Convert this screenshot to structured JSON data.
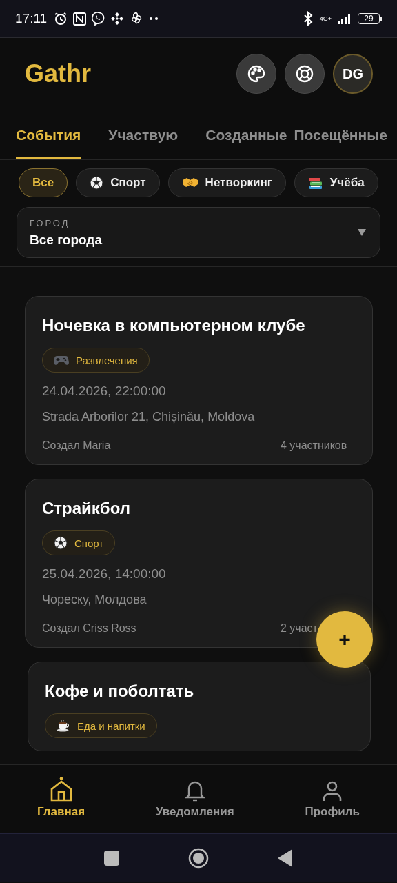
{
  "status_bar": {
    "time": "17:11",
    "network": "4G+",
    "battery": "29"
  },
  "header": {
    "title": "Gathr",
    "avatar": "DG"
  },
  "tabs": [
    {
      "label": "События",
      "selected": true
    },
    {
      "label": "Участвую",
      "selected": false
    },
    {
      "label": "Созданные",
      "selected": false
    },
    {
      "label": "Посещённые",
      "selected": false
    }
  ],
  "chips": [
    {
      "label": "Все",
      "kind": "all",
      "selected": true
    },
    {
      "label": "Спорт",
      "kind": "sport",
      "selected": false
    },
    {
      "label": "Нетворкинг",
      "kind": "networking",
      "selected": false
    },
    {
      "label": "Учёба",
      "kind": "study",
      "selected": false
    }
  ],
  "city_filter": {
    "label": "ГОРОД",
    "value": "Все города"
  },
  "events": [
    {
      "title": "Ночевка в компьютерном клубе",
      "tag": "Развлечения",
      "kind": "entertainment",
      "date": "24.04.2026, 22:00:00",
      "address": "Strada Arborilor 21, Chișinău, Moldova",
      "author": "Создал Maria",
      "participants": "4 участников"
    },
    {
      "title": "Страйкбол",
      "tag": "Спорт",
      "kind": "sport",
      "date": "25.04.2026, 14:00:00",
      "address": "Чореску, Молдова",
      "author": "Создал Criss Ross",
      "participants": "2 участ"
    },
    {
      "title": "Кофе и поболтать",
      "tag": "Еда и напитки",
      "kind": "food"
    }
  ],
  "fab": {
    "label": "+"
  },
  "bottom_nav": [
    {
      "label": "Главная",
      "kind": "home",
      "selected": true
    },
    {
      "label": "Уведомления",
      "kind": "bell",
      "selected": false
    },
    {
      "label": "Профиль",
      "kind": "person",
      "selected": false
    }
  ]
}
